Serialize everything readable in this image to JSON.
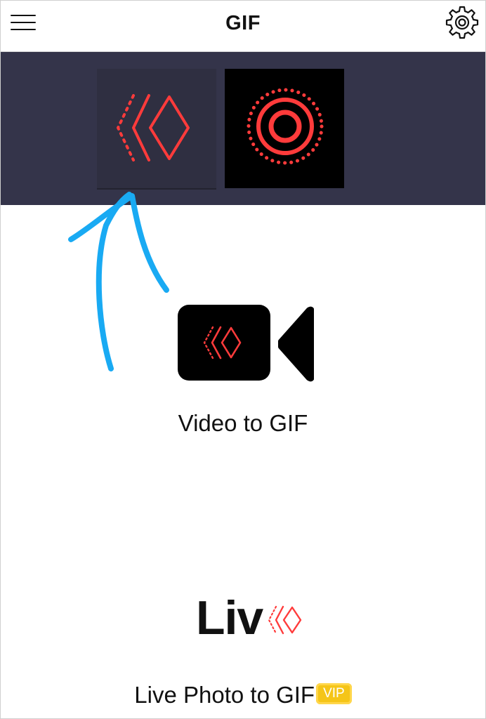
{
  "header": {
    "title": "GIF",
    "menu_icon": "hamburger-menu-icon",
    "settings_icon": "gear-icon"
  },
  "mode_tabs": [
    {
      "name": "video-mode",
      "icon": "double-chevron-diamond-icon",
      "selected": true
    },
    {
      "name": "live-photo-mode",
      "icon": "concentric-target-icon",
      "selected": false
    }
  ],
  "options": {
    "video": {
      "label": "Video to GIF",
      "icon": "video-camera-icon"
    },
    "live": {
      "logo_text": "Liv",
      "label": "Live Photo to GIF",
      "badge": "VIP"
    }
  },
  "colors": {
    "accent_red": "#ff3b3b",
    "band": "#34344a",
    "annotation": "#19aaf3",
    "vip": "#f5c518"
  }
}
